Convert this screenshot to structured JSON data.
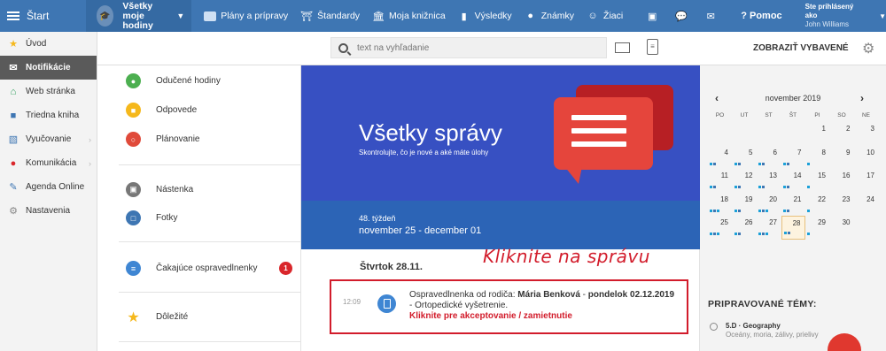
{
  "topbar": {
    "start": "Štart",
    "all_line1": "Všetky",
    "all_line2": "moje hodiny",
    "items": [
      {
        "icon": "briefcase-icon",
        "label": "Plány a prípravy"
      },
      {
        "icon": "shield-check-icon",
        "label": "Štandardy"
      },
      {
        "icon": "library-icon",
        "label": "Moja knižnica"
      },
      {
        "icon": "bar-chart-icon",
        "label": "Výsledky"
      },
      {
        "icon": "grade-circle-icon",
        "label": "Známky"
      },
      {
        "icon": "students-icon",
        "label": "Žiaci"
      }
    ],
    "help": "? Pomoc",
    "logged_in_label": "Ste prihlásený ako",
    "user_name": "John Williams"
  },
  "sidebar": {
    "items": [
      {
        "icon": "star-icon",
        "label": "Úvod",
        "arrow": false
      },
      {
        "icon": "envelope-icon",
        "label": "Notifikácie",
        "arrow": false,
        "active": true
      },
      {
        "icon": "home-icon",
        "label": "Web stránka",
        "arrow": false
      },
      {
        "icon": "book-icon",
        "label": "Triedna kniha",
        "arrow": false
      },
      {
        "icon": "book-open-icon",
        "label": "Vyučovanie",
        "arrow": true
      },
      {
        "icon": "chat-icon",
        "label": "Komunikácia",
        "arrow": true
      },
      {
        "icon": "pen-icon",
        "label": "Agenda Online",
        "arrow": false
      },
      {
        "icon": "gear-icon",
        "label": "Nastavenia",
        "arrow": false
      }
    ]
  },
  "search": {
    "placeholder": "text na vyhľadanie",
    "show_selected": "ZOBRAZIŤ VYBAVENÉ"
  },
  "midlist": {
    "items": [
      {
        "label": "Odučené hodiny",
        "color": "#4caf50"
      },
      {
        "label": "Odpovede",
        "color": "#f5b81c"
      },
      {
        "label": "Plánovanie",
        "color": "#e04a3a"
      },
      {
        "label": "Nástenka",
        "color": "#777777"
      },
      {
        "label": "Fotky",
        "color": "#3e76b3"
      },
      {
        "label": "Čakajúce ospravedlnenky",
        "color": "#3f86d3",
        "badge": "1"
      },
      {
        "label": "Dôležité",
        "color": "#f5b81c"
      }
    ]
  },
  "hero": {
    "title": "Všetky správy",
    "subtitle": "Skontrolujte, čo je nové a aké máte úlohy"
  },
  "week": {
    "number": "48. týždeň",
    "dates": "november 25 - december 01"
  },
  "day_header": "Štvrtok 28.11.",
  "annotation": "Kliknite na správu",
  "message": {
    "time": "12:09",
    "prefix": "Ospravedlnenka od rodiča: ",
    "name": "Mária Benková",
    "sep": " - ",
    "date": "pondelok 02.12.2019",
    "suffix": " - Ortopedické vyšetrenie.",
    "action": "Kliknite pre akceptovanie / zamietnutie"
  },
  "calendar": {
    "month": "november 2019",
    "prev": "‹",
    "next": "›",
    "weekdays": [
      "PO",
      "UT",
      "ST",
      "ŠT",
      "PI",
      "SO",
      "NE"
    ],
    "days": [
      [
        "",
        "",
        "",
        "",
        "1",
        "2",
        "3"
      ],
      [
        "4",
        "5",
        "6",
        "7",
        "8",
        "9",
        "10"
      ],
      [
        "11",
        "12",
        "13",
        "14",
        "15",
        "16",
        "17"
      ],
      [
        "18",
        "19",
        "20",
        "21",
        "22",
        "23",
        "24"
      ],
      [
        "25",
        "26",
        "27",
        "28",
        "29",
        "30",
        ""
      ]
    ],
    "today": "28"
  },
  "topics": {
    "heading": "PRIPRAVOVANÉ TÉMY:",
    "items": [
      {
        "title": "5.D · Geography",
        "subtitle": "Oceány, moria, zálivy, prielivy"
      }
    ]
  },
  "colors": {
    "topbar": "#3e76b3",
    "hero": "#3750c2",
    "week": "#2c64b6",
    "accent_red": "#d21c2b",
    "dot_blue": "#1aa0d8",
    "dot_dark": "#3e76b3"
  }
}
